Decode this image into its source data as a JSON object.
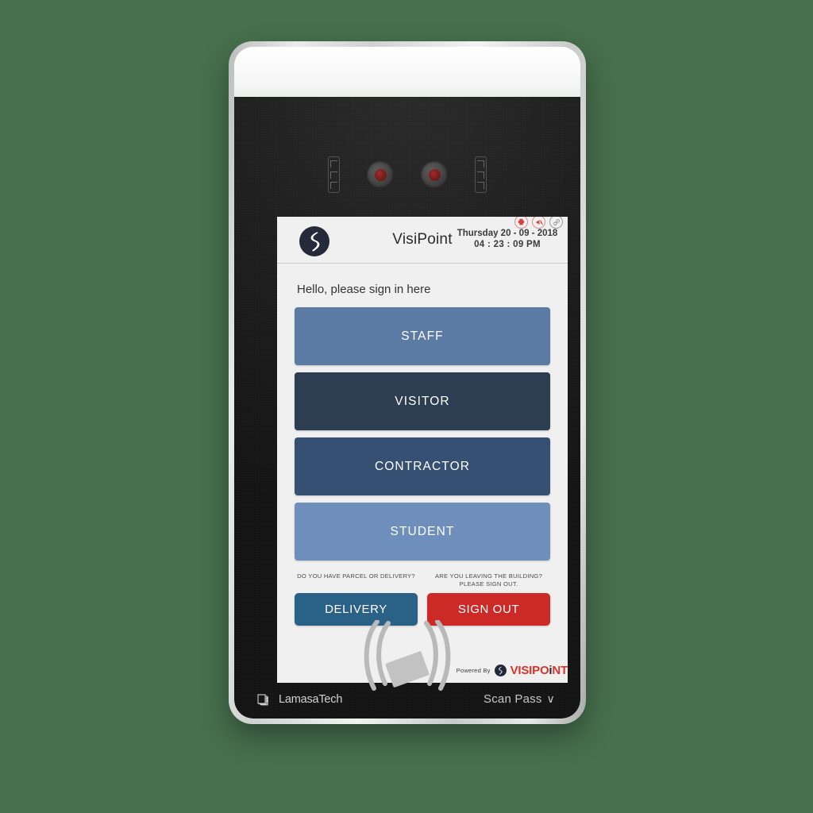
{
  "background_color": "#47704e",
  "device": {
    "name": "VisiPoint Visitor Management Kiosk",
    "frame_color": "#cfd2d0",
    "face_color": "#1c1c1c",
    "bottom_bar": {
      "vendor_logo_text": "LamasaTech",
      "scan_pass_label": "Scan Pass",
      "scan_pass_chevron": "∨",
      "nfc_icon_name": "nfc-scan-icon"
    },
    "sensors": {
      "left_ir_array": "ir-led-array",
      "left_camera": "ir-camera-lens",
      "right_camera": "ir-camera-lens",
      "right_ir_array": "ir-led-array"
    }
  },
  "screen": {
    "background": "#f0f0f0",
    "header": {
      "logo_icon": "visipoint-logo-icon",
      "title": "VisiPoint",
      "date": "Thursday 20 - 09 - 2018",
      "time": "04 : 23 : 09  PM",
      "status_icons": [
        {
          "name": "printer-icon",
          "color": "#d4403c"
        },
        {
          "name": "sound-muted-icon",
          "color": "#d4403c"
        },
        {
          "name": "link-icon",
          "color": "#8d8d8d"
        }
      ]
    },
    "main": {
      "greeting": "Hello, please sign in here",
      "role_buttons": [
        {
          "label": "STAFF",
          "color": "#5b7ba5"
        },
        {
          "label": "VISITOR",
          "color": "#2d3e52"
        },
        {
          "label": "CONTRACTOR",
          "color": "#355072"
        },
        {
          "label": "STUDENT",
          "color": "#6e8fbb"
        }
      ],
      "actions": [
        {
          "prompt": "DO YOU HAVE PARCEL OR DELIVERY?",
          "label": "DELIVERY",
          "color": "#2a6186"
        },
        {
          "prompt": "ARE YOU LEAVING THE BUILDING? PLEASE SIGN OUT.",
          "label": "SIGN OUT",
          "color": "#cb2a26"
        }
      ]
    },
    "footer": {
      "powered_by_label": "Powered By",
      "brand_mark_icon": "visipoint-logo-icon",
      "brand_part1": "VISIP",
      "brand_dot_i": "O",
      "brand_part2": "i",
      "brand_part3": "NT",
      "brand_color": "#d8342c"
    }
  }
}
